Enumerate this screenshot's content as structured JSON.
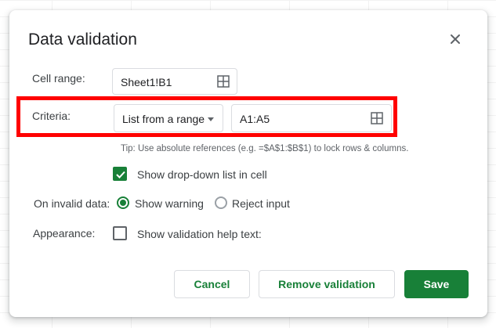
{
  "dialog": {
    "title": "Data validation",
    "close_icon": "close-icon"
  },
  "cell_range": {
    "label": "Cell range:",
    "value": "Sheet1!B1",
    "icon": "grid-icon"
  },
  "criteria": {
    "label": "Criteria:",
    "type_selected": "List from a range",
    "range_value": "A1:A5",
    "icon": "grid-icon"
  },
  "tip": "Tip: Use absolute references (e.g. =$A$1:$B$1) to lock rows & columns.",
  "show_dropdown": {
    "label": "Show drop-down list in cell",
    "checked": true
  },
  "invalid_data": {
    "label": "On invalid data:",
    "options": [
      "Show warning",
      "Reject input"
    ],
    "selected": "Show warning"
  },
  "appearance": {
    "label": "Appearance:",
    "help_text_label": "Show validation help text:",
    "checked": false
  },
  "buttons": {
    "cancel": "Cancel",
    "remove": "Remove validation",
    "save": "Save"
  },
  "colors": {
    "accent": "#188038",
    "highlight": "#ff0000"
  }
}
